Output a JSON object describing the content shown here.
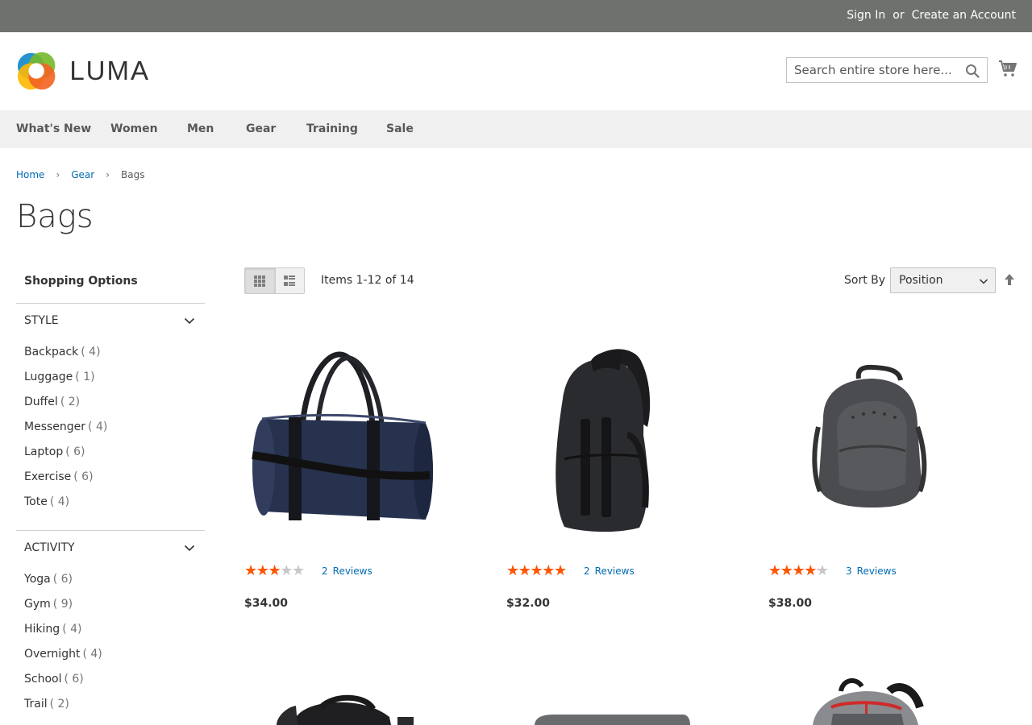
{
  "topbar": {
    "sign_in": "Sign In",
    "or": "or",
    "create_account": "Create an Account"
  },
  "header": {
    "brand": "LUMA",
    "search_placeholder": "Search entire store here...",
    "colors": {
      "orange": "#f26322",
      "yellow": "#ffb800",
      "green": "#75b82a",
      "blue": "#1a8ccd"
    }
  },
  "nav": [
    "What's New",
    "Women",
    "Men",
    "Gear",
    "Training",
    "Sale"
  ],
  "breadcrumb": {
    "home": "Home",
    "gear": "Gear",
    "current": "Bags"
  },
  "page_title": "Bags",
  "sidebar": {
    "title": "Shopping Options",
    "filters": [
      {
        "title": "STYLE",
        "options": [
          {
            "label": "Backpack",
            "count": "( 4)"
          },
          {
            "label": "Luggage",
            "count": "( 1)"
          },
          {
            "label": "Duffel",
            "count": "( 2)"
          },
          {
            "label": "Messenger",
            "count": "( 4)"
          },
          {
            "label": "Laptop",
            "count": "( 6)"
          },
          {
            "label": "Exercise",
            "count": "( 6)"
          },
          {
            "label": "Tote",
            "count": "( 4)"
          }
        ]
      },
      {
        "title": "ACTIVITY",
        "options": [
          {
            "label": "Yoga",
            "count": "( 6)"
          },
          {
            "label": "Gym",
            "count": "( 9)"
          },
          {
            "label": "Hiking",
            "count": "( 4)"
          },
          {
            "label": "Overnight",
            "count": "( 4)"
          },
          {
            "label": "School",
            "count": "( 6)"
          },
          {
            "label": "Trail",
            "count": "( 2)"
          }
        ]
      }
    ]
  },
  "toolbar": {
    "amount": "Items 1-12 of 14",
    "sort_label": "Sort By",
    "sort_value": "Position"
  },
  "products": [
    {
      "rating_percent": 50,
      "review_count": "2",
      "review_label": "Reviews",
      "price": "$34.00",
      "image": "navy-duffel-bag"
    },
    {
      "rating_percent": 90,
      "review_count": "2",
      "review_label": "Reviews",
      "price": "$32.00",
      "image": "black-sling-backpack"
    },
    {
      "rating_percent": 70,
      "review_count": "3",
      "review_label": "Reviews",
      "price": "$38.00",
      "image": "gray-backpack"
    }
  ]
}
